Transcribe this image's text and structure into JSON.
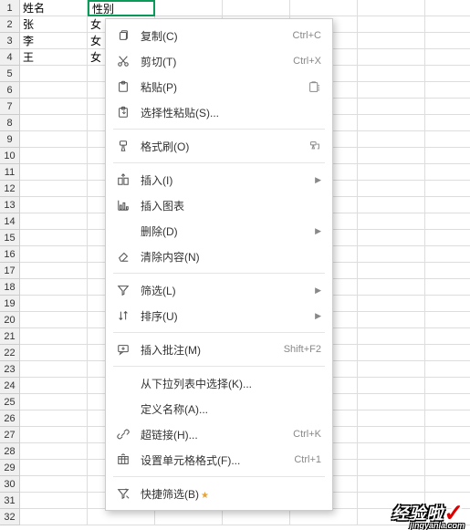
{
  "grid": {
    "rows": 32,
    "headers_col1": "姓名",
    "headers_col2": "性别",
    "data": [
      {
        "c1": "张",
        "c2": "女"
      },
      {
        "c1": "李",
        "c2": "女"
      },
      {
        "c1": "王",
        "c2": "女"
      }
    ],
    "selected_cell": "性别"
  },
  "menu": {
    "copy": "复制(C)",
    "copy_sc": "Ctrl+C",
    "cut": "剪切(T)",
    "cut_sc": "Ctrl+X",
    "paste": "粘贴(P)",
    "paste_special": "选择性粘贴(S)...",
    "format_painter": "格式刷(O)",
    "insert": "插入(I)",
    "insert_chart": "插入图表",
    "delete": "删除(D)",
    "clear": "清除内容(N)",
    "filter": "筛选(L)",
    "sort": "排序(U)",
    "insert_comment": "插入批注(M)",
    "insert_comment_sc": "Shift+F2",
    "pick_list": "从下拉列表中选择(K)...",
    "define_name": "定义名称(A)...",
    "hyperlink": "超链接(H)...",
    "hyperlink_sc": "Ctrl+K",
    "format_cells": "设置单元格格式(F)...",
    "format_cells_sc": "Ctrl+1",
    "quick_filter": "快捷筛选(B)"
  },
  "watermark": {
    "main": "经验啦",
    "sub": "jingyanla.com"
  }
}
